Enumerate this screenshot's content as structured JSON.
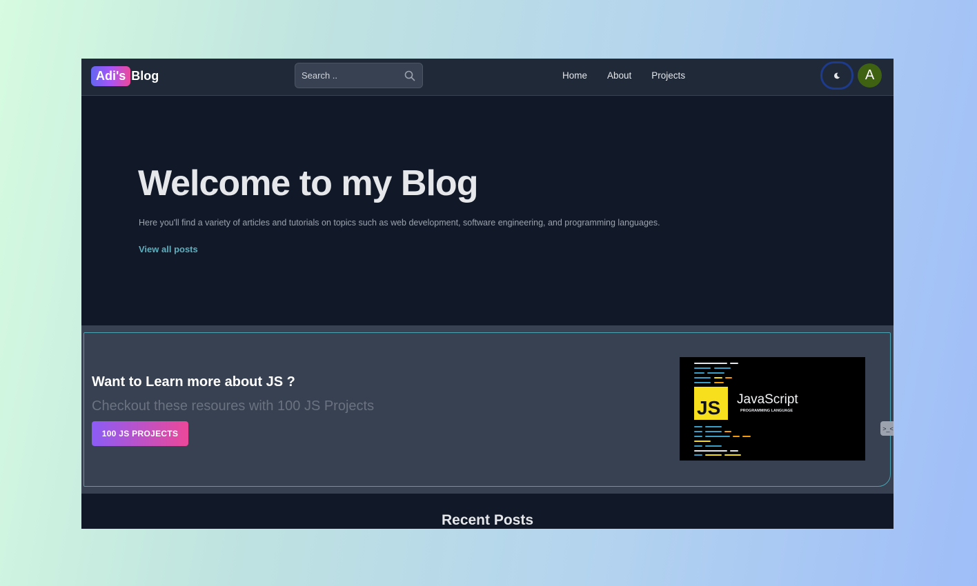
{
  "navbar": {
    "logo_badge": "Adi's",
    "logo_text": "Blog",
    "search_placeholder": "Search ..",
    "links": [
      "Home",
      "About",
      "Projects"
    ],
    "theme_icon": "moon-icon",
    "avatar_initial": "A"
  },
  "hero": {
    "title": "Welcome to my Blog",
    "description": "Here you'll find a variety of articles and tutorials on topics such as web development, software engineering, and programming languages.",
    "link_label": "View all posts"
  },
  "promo": {
    "heading": "Want to Learn more about JS ?",
    "subheading": "Checkout these resoures with 100 JS Projects",
    "button_label": "100 JS PROJECTS",
    "image": {
      "badge_text": "JS",
      "title": "JavaScript",
      "subtitle": "PROGRAMMING LANGUAGE"
    },
    "side_tab_icon": "terminal-icon"
  },
  "recent": {
    "title": "Recent Posts"
  },
  "colors": {
    "accent_link": "#5eaebe",
    "button_gradient_start": "#8b5cf6",
    "button_gradient_end": "#ec4899",
    "js_yellow": "#f7df1e"
  }
}
